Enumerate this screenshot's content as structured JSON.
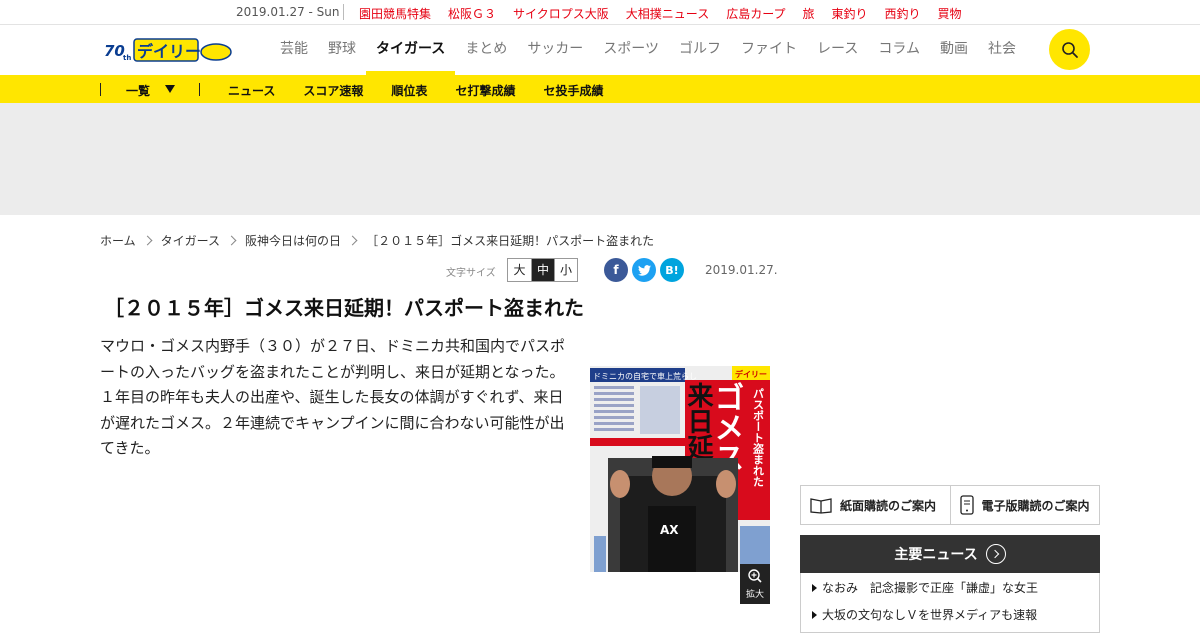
{
  "topbar": {
    "date": "2019.01.27 - Sun",
    "links": [
      "園田競馬特集",
      "松阪Ｇ３",
      "サイクロプス大阪",
      "大相撲ニュース",
      "広島カープ",
      "旅",
      "東釣り",
      "西釣り",
      "買物"
    ]
  },
  "header": {
    "logo_text": "デイリー",
    "nav": [
      {
        "label": "芸能"
      },
      {
        "label": "野球"
      },
      {
        "label": "タイガース",
        "active": true
      },
      {
        "label": "まとめ"
      },
      {
        "label": "サッカー"
      },
      {
        "label": "スポーツ"
      },
      {
        "label": "ゴルフ"
      },
      {
        "label": "ファイト"
      },
      {
        "label": "レース"
      },
      {
        "label": "コラム"
      },
      {
        "label": "動画"
      },
      {
        "label": "社会"
      }
    ]
  },
  "subnav": {
    "list_label": "一覧",
    "links": [
      "ニュース",
      "スコア速報",
      "順位表",
      "セ打撃成績",
      "セ投手成績"
    ]
  },
  "breadcrumb": [
    "ホーム",
    "タイガース",
    "阪神今日は何の日",
    "［２０１５年］ゴメス来日延期！パスポート盗まれた"
  ],
  "toolbar": {
    "font_size_label": "文字サイズ",
    "sizes": [
      "大",
      "中",
      "小"
    ],
    "selected_size": "中",
    "date": "2019.01.27."
  },
  "article": {
    "title": "［２０１５年］ゴメス来日延期！パスポート盗まれた",
    "body": "マウロ・ゴメス内野手（３０）が２７日、ドミニカ共和国内でパスポートの入ったバッグを盗まれたことが判明し、来日が延期となった。１年目の昨年も夫人の出産や、誕生した長女の体調がすぐれず、来日が遅れたゴメス。２年連続でキャンプインに間に合わない可能性が出てきた。",
    "zoom_label": "拡大"
  },
  "paper_image": {
    "headline_big": "ゴメス",
    "headline_sub": "来日延期",
    "kicker": "パスポート盗まれた",
    "top_strip": "ドミニカの自宅で車上荒らし",
    "logo": "デイリー",
    "shirt": "AX"
  },
  "sidebar": {
    "paper_subscribe": "紙面購読のご案内",
    "digital_subscribe": "電子版購読のご案内",
    "main_news_title": "主要ニュース",
    "main_news": [
      "なおみ　記念撮影で正座「謙虚」な女王",
      "大坂の文句なしＶを世界メディアも速報"
    ]
  },
  "colors": {
    "accent_yellow": "#ffe600",
    "link_red": "#e60012",
    "dark": "#333333"
  }
}
